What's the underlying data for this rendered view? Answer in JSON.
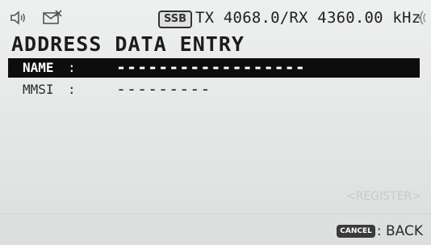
{
  "status_bar": {
    "speaker_icon": "speaker-icon",
    "mail_icon": "mail-icon",
    "mode": "SSB",
    "frequency": "TX 4068.0/RX 4360.00 kHz",
    "signal_icon": "signal-icon"
  },
  "page": {
    "title": "ADDRESS DATA ENTRY"
  },
  "fields": [
    {
      "label": "NAME",
      "colon": ":",
      "value": "------------------",
      "selected": true
    },
    {
      "label": "MMSI",
      "colon": ":",
      "value": "---------",
      "selected": false
    }
  ],
  "softkeys": {
    "register": "<REGISTER>",
    "cancel_badge": "CANCEL",
    "back": ": BACK"
  },
  "colors": {
    "background": "#e4e7e6",
    "selected_row": "#0d0d0d",
    "text": "#2a2a2a",
    "disabled": "#c5c9c9"
  }
}
